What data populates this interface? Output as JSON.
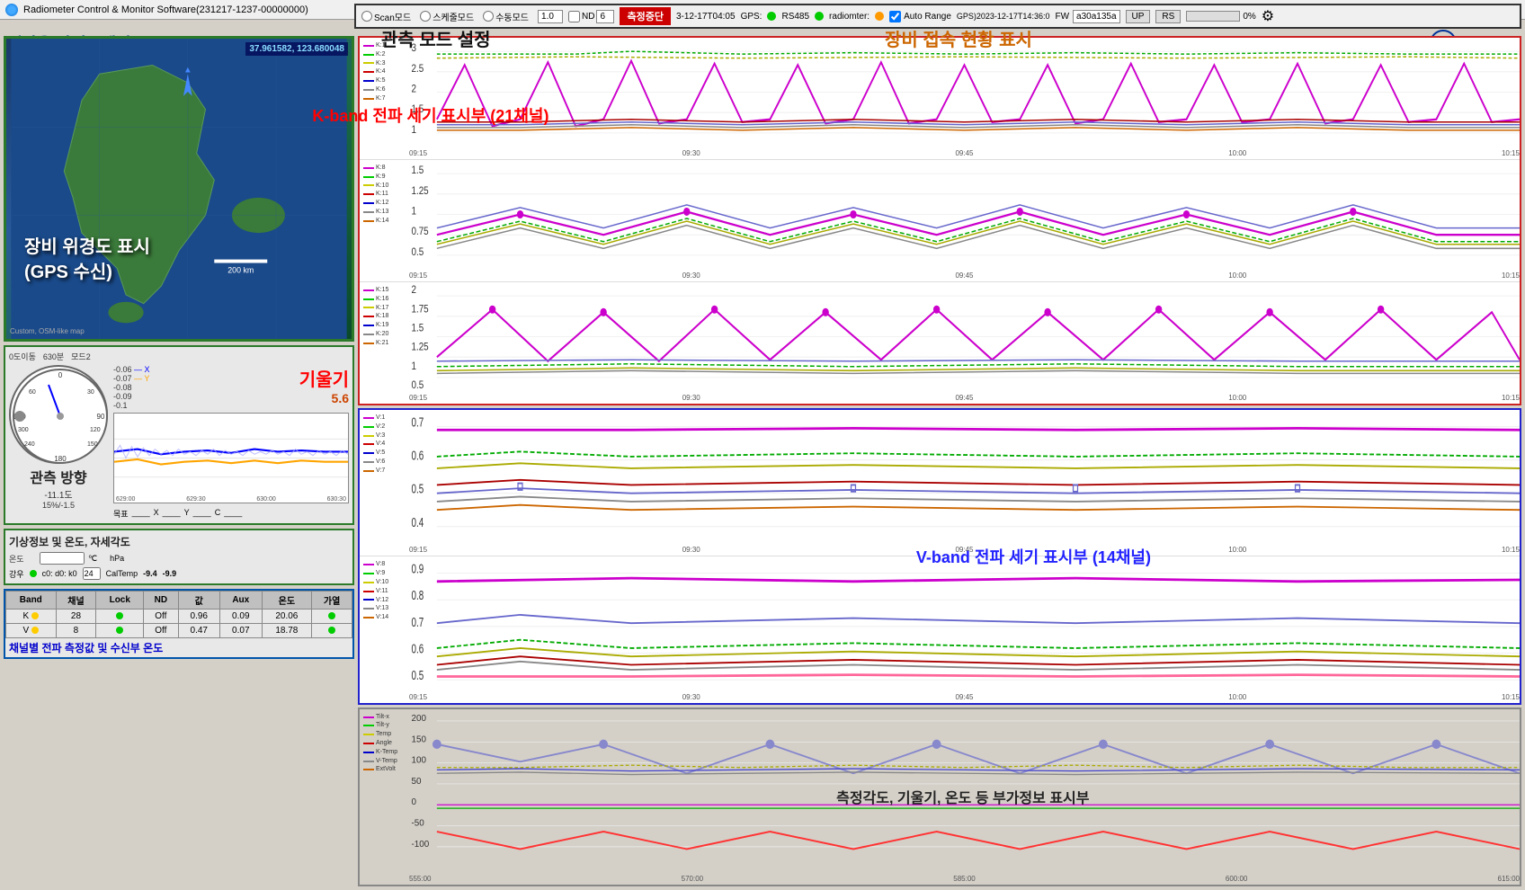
{
  "titlebar": {
    "title": "Radiometer Control & Monitor Software(231217-1237-00000000)",
    "close_label": "✕"
  },
  "app_header": {
    "app_title": "해상용 라디오메터",
    "university_label": "목포해양대학교"
  },
  "overlay_titles": {
    "mode_setting": "관측 모드 설정",
    "device_status": "장비 접속 현황 표시"
  },
  "mode_bar": {
    "scan_label": "Scan모드",
    "schedule_label": "스케줄모드",
    "manual_label": "수동모드",
    "mode_value": "1.0",
    "nd_label": "ND",
    "nd_value": "6",
    "measure_btn": "측정중단",
    "timestamp": "3-12-17T04:05",
    "gps_label": "GPS:",
    "rs485_label": "RS485",
    "radiometer_label": "radiomter:",
    "autorange_label": "Auto Range",
    "gps_time": "GPS)2023-12-17T14:36:0",
    "fw_label": "FW",
    "fw_value": "a30a135a",
    "up_label": "UP",
    "rs_label": "RS",
    "progress": "0%",
    "gear": "⚙"
  },
  "map_section": {
    "coords": "37.961582, 123.680048",
    "label_line1": "장비 위경도 표시",
    "label_line2": "(GPS 수신)",
    "scale_label": "200 km",
    "custom_label": "Custom, OSM-like map"
  },
  "compass_section": {
    "header_items": [
      "0도이동",
      "630분",
      "모드2"
    ],
    "observation_label": "관측 방향",
    "deg_display": "-11.1도",
    "pct_display": "15%/-1.5",
    "target_label": "목표",
    "x_label": "X",
    "y_label": "Y",
    "c_label": "C",
    "weather_label": "기상정보 및 온도, 자세각도",
    "temp_label": "온도",
    "temp_unit": "℃",
    "rain_label": "강우",
    "rain_val": "c0: d0: k0",
    "cal_label": "CalTemp",
    "cal_val1": "-9.4",
    "cal_val2": "-9.9",
    "tilt_label": "기울기",
    "tilt_value": "5.6"
  },
  "channel_table": {
    "headers": [
      "Band",
      "채널",
      "Lock",
      "ND",
      "값",
      "Aux",
      "온도",
      "가열"
    ],
    "rows": [
      {
        "band": "K",
        "band_color": "yellow",
        "channels": "28",
        "lock_color": "green",
        "nd": "Off",
        "value": "0.96",
        "aux": "0.09",
        "temp": "20.06",
        "heat_color": "green"
      },
      {
        "band": "V",
        "band_color": "yellow",
        "channels": "8",
        "lock_color": "green",
        "nd": "Off",
        "value": "0.47",
        "aux": "0.07",
        "temp": "18.78",
        "heat_color": "green"
      }
    ],
    "footer": "채널별 전파 측정값 및 수신부 온도"
  },
  "k_band_chart": {
    "title": "K-band 전파 세기 표시부 (21채널)",
    "sub1_legend": [
      "K:1",
      "K:2",
      "K:3",
      "K:4",
      "K:5",
      "K:6",
      "K:7"
    ],
    "sub2_legend": [
      "K:8",
      "K:9",
      "K:10",
      "K:11",
      "K:12",
      "K:13",
      "K:14"
    ],
    "sub3_legend": [
      "K:15",
      "K:16",
      "K:17",
      "K:18",
      "K:19",
      "K:20",
      "K:21"
    ],
    "x_ticks": [
      "09:15",
      "09:30",
      "09:45",
      "10:00",
      "10:15"
    ]
  },
  "v_band_chart": {
    "title": "V-band 전파 세기 표시부 (14채널)",
    "sub1_legend": [
      "V:1",
      "V:2",
      "V:3",
      "V:4",
      "V:5",
      "V:6",
      "V:7"
    ],
    "sub2_legend": [
      "V:8",
      "V:9",
      "V:10",
      "V:11",
      "V:12",
      "V:13",
      "V:14"
    ],
    "x_ticks": [
      "09:15",
      "09:30",
      "09:45",
      "10:00",
      "10:15"
    ]
  },
  "extra_chart": {
    "title": "측정각도, 기울기, 온도 등 부가정보 표시부",
    "legend": [
      "Tilt-x",
      "Tilt-y",
      "Temp",
      "Angle",
      "K-Temp",
      "V-Temp",
      "ExtVolt"
    ],
    "x_ticks": [
      "555:00",
      "570:00",
      "585:00",
      "600:00",
      "615:00"
    ]
  }
}
